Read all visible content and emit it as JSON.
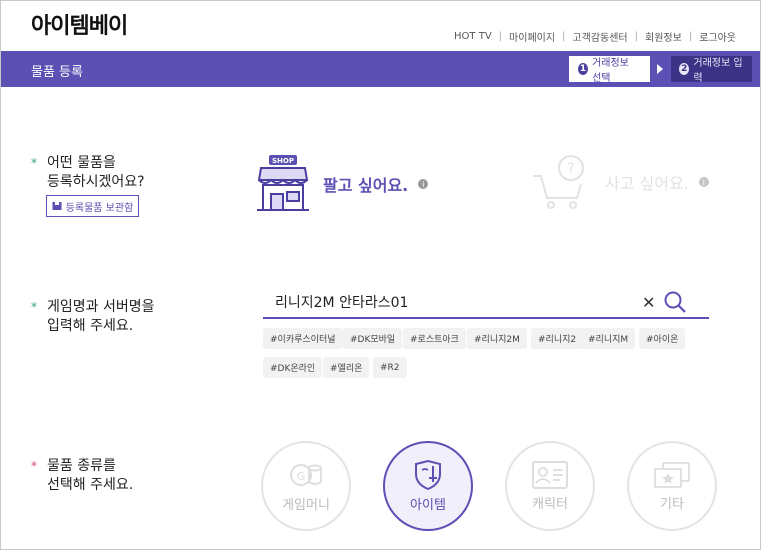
{
  "brand": {
    "logo_text": "아이템베이"
  },
  "top_nav": [
    "HOT TV",
    "마이페이지",
    "고객감동센터",
    "회원정보",
    "로그아웃"
  ],
  "title_bar": {
    "title": "물품 등록",
    "steps": [
      {
        "num": "1",
        "label": "거래정보 선택",
        "active": true
      },
      {
        "num": "2",
        "label": "거래정보 입력",
        "active": false
      }
    ]
  },
  "section_type": {
    "question_line1": "어떤 물품을",
    "question_line2": "등록하시겠어요?",
    "storage_button": "등록물품 보관함",
    "sell_label": "팔고 싶어요.",
    "buy_label": "사고 싶어요.",
    "shop_sign": "SHOP"
  },
  "section_game": {
    "question_line1": "게임명과 서버명을",
    "question_line2": "입력해 주세요.",
    "search_value": "리니지2M 안타라스01",
    "tags": [
      "#이카루스이터널",
      "#DK모바일",
      "#로스트아크",
      "#리니지2M",
      "#리니지2",
      "#리니지M",
      "#아이온",
      "#DK온라인",
      "#엘리온",
      "#R2"
    ]
  },
  "section_category": {
    "question_line1": "물품 종류를",
    "question_line2": "선택해 주세요.",
    "categories": [
      {
        "label": "게임머니",
        "active": false
      },
      {
        "label": "아이템",
        "active": true
      },
      {
        "label": "캐릭터",
        "active": false
      },
      {
        "label": "기타",
        "active": false
      }
    ]
  },
  "colors": {
    "accent": "#5c50b4",
    "accent_dark": "#3c3387",
    "star_green": "#3aa57a",
    "star_red": "#e0457b"
  }
}
